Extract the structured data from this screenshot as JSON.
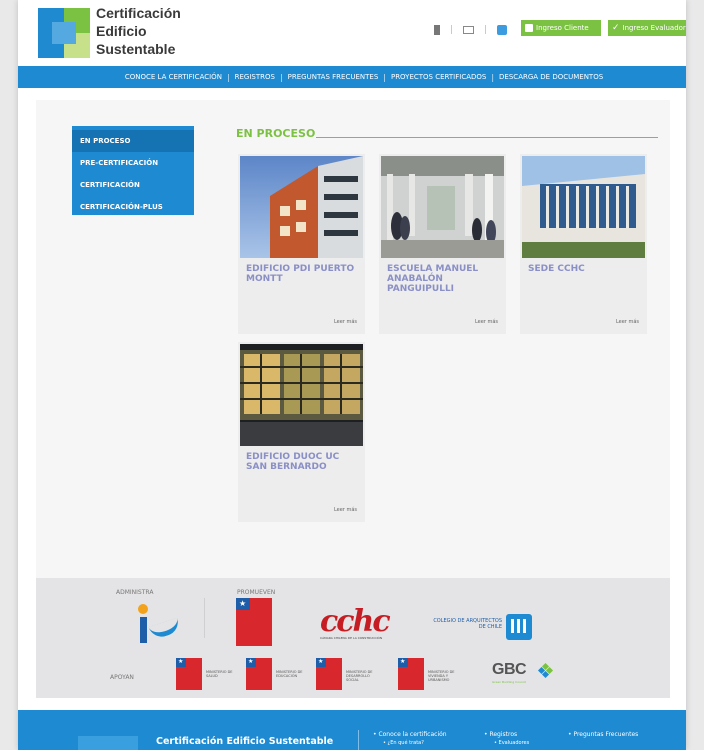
{
  "header": {
    "logo_lines": [
      "Certificación",
      "Edificio",
      "Sustentable"
    ],
    "btn_cliente": "Ingreso Cliente",
    "btn_evaluador": "Ingreso Evaluador"
  },
  "nav": {
    "items": [
      "CONOCE LA CERTIFICACIÓN",
      "REGISTROS",
      "PREGUNTAS FRECUENTES",
      "PROYECTOS CERTIFICADOS",
      "DESCARGA DE DOCUMENTOS"
    ],
    "separator": "|"
  },
  "sidebar": {
    "items": [
      {
        "label": "EN PROCESO"
      },
      {
        "label": "PRE-CERTIFICACIÓN"
      },
      {
        "label": "CERTIFICACIÓN"
      },
      {
        "label": "CERTIFICACIÓN-PLUS"
      }
    ]
  },
  "main": {
    "section_title": "EN PROCESO",
    "more_label": "Leer más",
    "projects": [
      {
        "title": "EDIFICIO PDI PUERTO MONTT"
      },
      {
        "title": "ESCUELA MANUEL ANABALÓN PANGUIPULLI"
      },
      {
        "title": "SEDE CCHC"
      },
      {
        "title": "EDIFICIO DUOC UC SAN BERNARDO"
      }
    ]
  },
  "sponsors": {
    "administra_label": "ADMINISTRA",
    "promueven_label": "PROMUEVEN",
    "apoyan_label": "APOYAN",
    "cchc_text": "cchc",
    "cchc_sub": "CÁMARA CHILENA DE LA CONSTRUCCIÓN",
    "colegio_text": "COLEGIO DE ARQUITECTOS DE CHILE",
    "ministries": [
      "MINISTERIO DE SALUD",
      "MINISTERIO DE EDUCACIÓN",
      "MINISTERIO DE DESARROLLO SOCIAL",
      "MINISTERIO DE VIVIENDA Y URBANISMO"
    ],
    "gbc_text": "GBC",
    "gbc_sub": "Green Building Council"
  },
  "footer": {
    "title": "Certificación Edificio Sustentable",
    "col1": {
      "main": "• Conoce la certificación",
      "sub": "• ¿En qué trata?"
    },
    "col2": {
      "main": "• Registros",
      "sub": "• Evaluadores"
    },
    "col3": {
      "main": "• Preguntas Frecuentes"
    }
  }
}
